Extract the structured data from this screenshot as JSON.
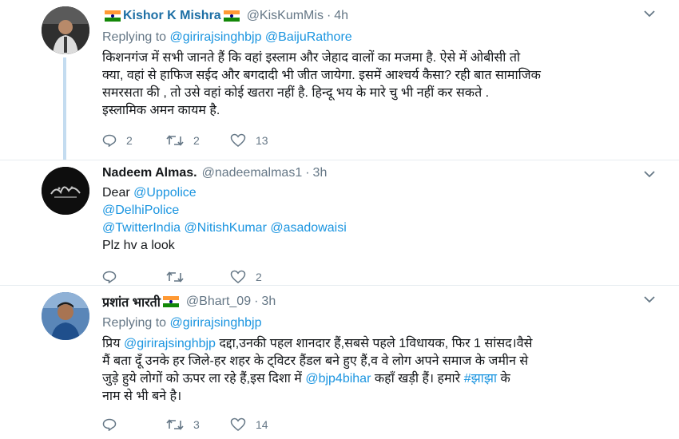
{
  "tweets": [
    {
      "name": "Kishor K Mishra",
      "handle": "@KisKumMis",
      "separator": "·",
      "time": "4h",
      "replying_label": "Replying to",
      "replying_to": [
        "@girirajsinghbjp",
        "@BaijuRathore"
      ],
      "lines": [
        "किशनगंज में सभी जानते हैं कि वहां इस्लाम और जेहाद वालों का मजमा है. ऐसे में ओबीसी तो",
        "क्या, वहां से हाफिज सईद और बगदादी भी जीत जायेगा. इसमें आश्चर्य कैसा? रही बात सामाजिक",
        "समरसता की , तो उसे वहां कोई खतरा नहीं है. हिन्दू भय  के मारे चु भी नहीं कर सकते .",
        "इस्लामिक अमन कायम है."
      ],
      "replies": "2",
      "retweets": "2",
      "likes": "13"
    },
    {
      "name": "Nadeem Almas.",
      "handle": "@nadeemalmas1",
      "separator": "·",
      "time": "3h",
      "line1_prefix": "Dear",
      "line1_mention": "@Uppolice",
      "line2_mention": "@DelhiPolice",
      "line3_mentions": [
        "@TwitterIndia",
        "@NitishKumar",
        "@asadowaisi"
      ],
      "line4": "Plz hv a look",
      "replies": "",
      "retweets": "",
      "likes": "2"
    },
    {
      "name": "प्रशांत भारती",
      "handle": "@Bhart_09",
      "separator": "·",
      "time": "3h",
      "replying_label": "Replying to",
      "replying_to": [
        "@girirajsinghbjp"
      ],
      "l1_a": "प्रिय",
      "l1_mention": "@girirajsinghbjp",
      "l1_b": "दद्दा,उनकी पहल शानदार हैं,सबसे पहले 1विधायक, फिर 1 सांसद।वैसे",
      "l2": "मैं बता दूँ उनके हर जिले-हर शहर के ट्विटर हैंडल बने हुए हैं,व वे लोग अपने समाज के जमीन से",
      "l3_a": "जुड़े हुये लोगों को ऊपर ला रहे हैं,इस दिशा में",
      "l3_mention": "@bjp4bihar",
      "l3_b": "कहाँ खड़ी हैं। हमारे",
      "l3_hashtag": "#झाझा",
      "l3_c": "के",
      "l4": "नाम से भी बने है।",
      "replies": "",
      "retweets": "3",
      "likes": "14"
    }
  ],
  "icons": {
    "reply": "reply-icon",
    "retweet": "retweet-icon",
    "like": "heart-icon",
    "menu": "chevron-down-icon",
    "flag": "india-flag-icon"
  },
  "colors": {
    "link": "#1b95e0",
    "muted": "#657786",
    "thread_line": "#c4dcf0"
  }
}
